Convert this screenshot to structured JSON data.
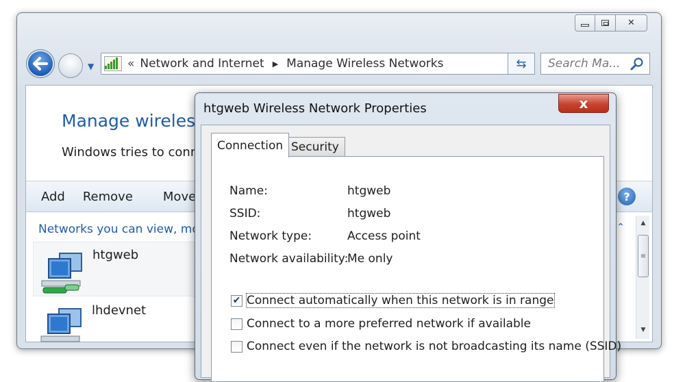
{
  "explorer": {
    "address_chevron": "«",
    "breadcrumb": [
      "Network and Internet",
      "Manage Wireless Networks"
    ],
    "search_placeholder": "Search Ma...",
    "page_title": "Manage wireless n",
    "page_desc": "Windows tries to conne",
    "toolbar": [
      "Add",
      "Remove",
      "Move d"
    ],
    "group_header": "Networks you can view, mo",
    "networks": [
      {
        "name": "htgweb"
      },
      {
        "name": "lhdevnet"
      }
    ]
  },
  "dialog": {
    "title": "htgweb Wireless Network Properties",
    "close_label": "x",
    "tabs": [
      "Connection",
      "Security"
    ],
    "properties": [
      {
        "label": "Name:",
        "value": "htgweb"
      },
      {
        "label": "SSID:",
        "value": "htgweb"
      },
      {
        "label": "Network type:",
        "value": "Access point"
      },
      {
        "label": "Network availability:",
        "value": "Me only"
      }
    ],
    "options": [
      {
        "label": "Connect automatically when this network is in range",
        "checked": true
      },
      {
        "label": "Connect to a more preferred network if available",
        "checked": false
      },
      {
        "label": "Connect even if the network is not broadcasting its name (SSID)",
        "checked": false
      }
    ]
  },
  "colors": {
    "accent": "#1e5ca8",
    "close": "#c7432d"
  }
}
